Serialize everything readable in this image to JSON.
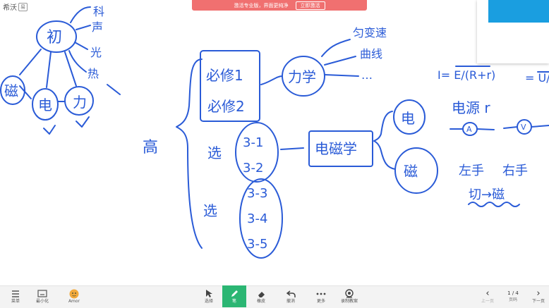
{
  "app": {
    "name": "希沃",
    "badge": "易"
  },
  "promo": {
    "text": "激活专业版，界面更纯净",
    "button": "立即激活"
  },
  "board": {
    "top_left": {
      "center": "初",
      "branches": [
        "力",
        "电",
        "磁"
      ],
      "right_list": [
        "科",
        "声",
        "光",
        "热"
      ]
    },
    "main": {
      "left_label": "高",
      "required": [
        "必修1",
        "必修2"
      ],
      "elective_label_1": "选",
      "elective_group_1": [
        "3-1",
        "3-2"
      ],
      "elective_label_2": "选",
      "elective_group_2": [
        "3-3",
        "3-4",
        "3-5"
      ],
      "mechanics": "力学",
      "mech_list": [
        "匀变速",
        "曲线",
        "…"
      ],
      "em": "电磁学",
      "em_branches": [
        "电",
        "磁"
      ],
      "circuit": "电源 r",
      "formula_1": "I= E/(R+r)",
      "formula_2": "= U/R",
      "ammeter": "A",
      "voltmeter": "V",
      "magnet_items": [
        "左手",
        "右手",
        "切→磁"
      ]
    }
  },
  "toolbar": {
    "left": [
      {
        "label": "菜单",
        "icon": "menu-icon"
      },
      {
        "label": "最小化",
        "icon": "minimize-icon"
      },
      {
        "label": "Amor",
        "icon": "avatar-icon"
      }
    ],
    "center": [
      {
        "label": "选择",
        "icon": "cursor-icon"
      },
      {
        "label": "笔",
        "icon": "pen-icon"
      },
      {
        "label": "橡皮",
        "icon": "eraser-icon"
      },
      {
        "label": "撤消",
        "icon": "undo-icon"
      },
      {
        "label": "更多",
        "icon": "more-icon"
      },
      {
        "label": "录制教案",
        "icon": "record-icon"
      }
    ],
    "pager": {
      "prev": "上一页",
      "page": "1 / 4",
      "page_label": "页码",
      "next": "下一页"
    }
  },
  "colors": {
    "ink": "#2a5bd7",
    "active_tool": "#2bb673",
    "promo": "#f07070",
    "panel_blue": "#1a9ee0"
  }
}
